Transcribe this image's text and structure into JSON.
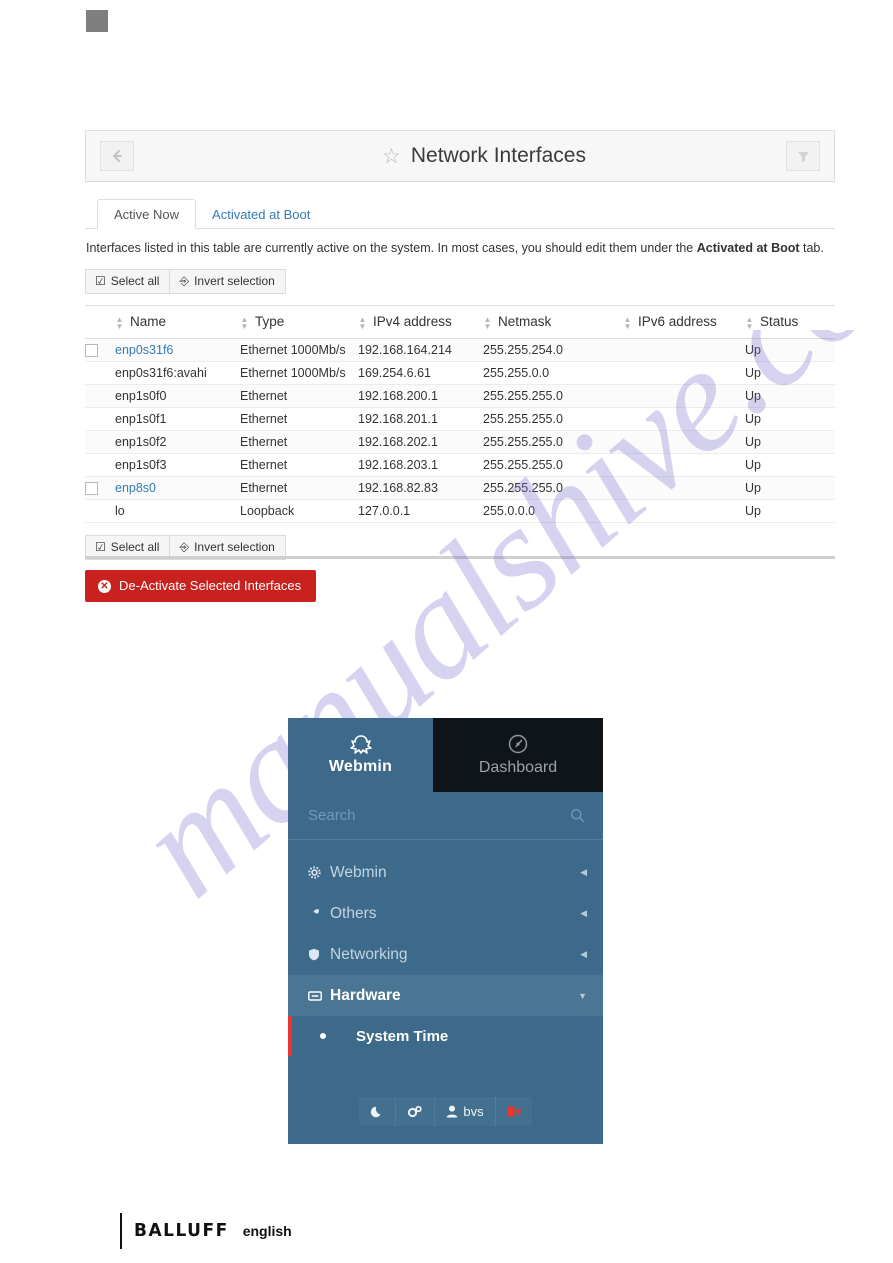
{
  "page": {
    "watermark_text": "manualshive.com"
  },
  "card": {
    "title": "Network Interfaces",
    "back_icon": "arrow-left-icon",
    "filter_icon": "funnel-icon",
    "star_icon": "star-icon",
    "tabs": [
      {
        "label": "Active Now",
        "active": true
      },
      {
        "label": "Activated at Boot",
        "active": false
      }
    ],
    "description_prefix": "Interfaces listed in this table are currently active on the system. In most cases, you should edit them under the ",
    "description_bold": "Activated at Boot",
    "description_suffix": " tab.",
    "toolbar": {
      "select_all_label": "Select all",
      "invert_selection_label": "Invert selection",
      "select_all_icon": "checkbox-icon",
      "invert_icon": "share-icon"
    },
    "table": {
      "columns": [
        "Name",
        "Type",
        "IPv4 address",
        "Netmask",
        "IPv6 address",
        "Status"
      ],
      "rows": [
        {
          "checkbox": true,
          "name": "enp0s31f6",
          "link": true,
          "type": "Ethernet 1000Mb/s",
          "ipv4": "192.168.164.214",
          "netmask": "255.255.254.0",
          "ipv6": "",
          "status": "Up"
        },
        {
          "checkbox": false,
          "name": "enp0s31f6:avahi",
          "link": false,
          "type": "Ethernet 1000Mb/s",
          "ipv4": "169.254.6.61",
          "netmask": "255.255.0.0",
          "ipv6": "",
          "status": "Up"
        },
        {
          "checkbox": false,
          "name": "enp1s0f0",
          "link": false,
          "type": "Ethernet",
          "ipv4": "192.168.200.1",
          "netmask": "255.255.255.0",
          "ipv6": "",
          "status": "Up"
        },
        {
          "checkbox": false,
          "name": "enp1s0f1",
          "link": false,
          "type": "Ethernet",
          "ipv4": "192.168.201.1",
          "netmask": "255.255.255.0",
          "ipv6": "",
          "status": "Up"
        },
        {
          "checkbox": false,
          "name": "enp1s0f2",
          "link": false,
          "type": "Ethernet",
          "ipv4": "192.168.202.1",
          "netmask": "255.255.255.0",
          "ipv6": "",
          "status": "Up"
        },
        {
          "checkbox": false,
          "name": "enp1s0f3",
          "link": false,
          "type": "Ethernet",
          "ipv4": "192.168.203.1",
          "netmask": "255.255.255.0",
          "ipv6": "",
          "status": "Up"
        },
        {
          "checkbox": true,
          "name": "enp8s0",
          "link": true,
          "type": "Ethernet",
          "ipv4": "192.168.82.83",
          "netmask": "255.255.255.0",
          "ipv6": "",
          "status": "Up"
        },
        {
          "checkbox": false,
          "name": "lo",
          "link": false,
          "type": "Loopback",
          "ipv4": "127.0.0.1",
          "netmask": "255.0.0.0",
          "ipv6": "",
          "status": "Up"
        }
      ]
    },
    "deactivate_button": {
      "label": "De-Activate Selected Interfaces",
      "icon": "circle-x-icon",
      "color": "#c9211e"
    }
  },
  "webmin": {
    "brand_label": "Webmin",
    "brand_icon": "webmin-logo-icon",
    "dashboard_label": "Dashboard",
    "dashboard_icon": "gauge-icon",
    "search_placeholder": "Search",
    "search_icon": "search-icon",
    "menu": [
      {
        "label": "Webmin",
        "icon": "gear-icon",
        "caret": "chevron-left-icon",
        "open": false
      },
      {
        "label": "Others",
        "icon": "tools-icon",
        "caret": "chevron-left-icon",
        "open": false
      },
      {
        "label": "Networking",
        "icon": "shield-icon",
        "caret": "chevron-left-icon",
        "open": false
      },
      {
        "label": "Hardware",
        "icon": "drawer-icon",
        "caret": "chevron-down-icon",
        "open": true
      }
    ],
    "submenu": [
      {
        "label": "System Time",
        "bullet": "dot-icon"
      }
    ],
    "footer": {
      "theme_icon": "moon-icon",
      "settings_icon": "gears-icon",
      "user_icon": "user-icon",
      "user_label": "bvs",
      "logout_icon": "logout-icon"
    },
    "accent_color": "#3d6a8a",
    "logout_color": "#e8362d"
  },
  "footer": {
    "brand": "BALLUFF",
    "language": "english"
  }
}
